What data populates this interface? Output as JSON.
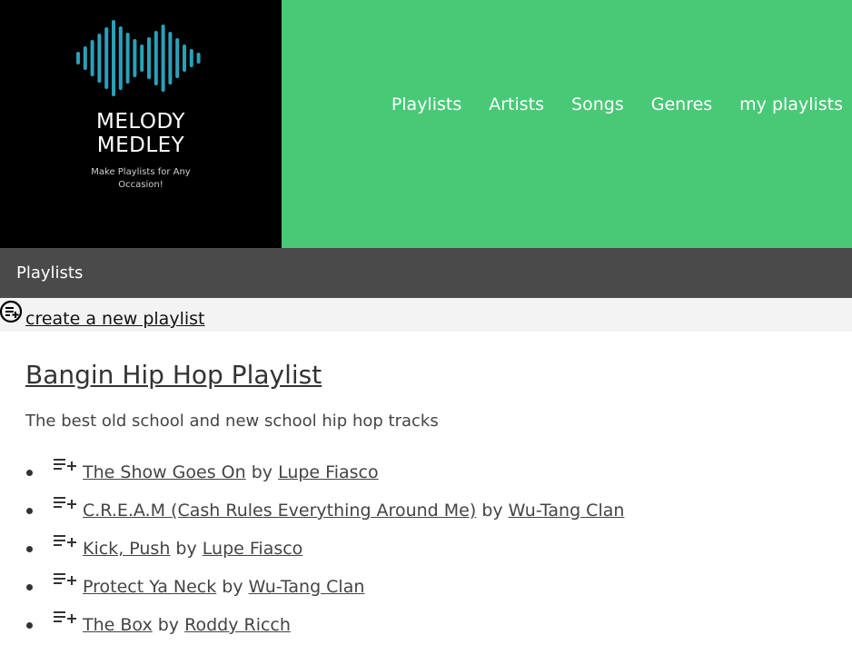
{
  "brand": {
    "name_line1": "MELODY",
    "name_line2": "MEDLEY",
    "tagline_line1": "Make Playlists for Any",
    "tagline_line2": "Occasion!"
  },
  "nav": {
    "items": [
      "Playlists",
      "Artists",
      "Songs",
      "Genres",
      "my playlists"
    ]
  },
  "subheader": {
    "title": "Playlists"
  },
  "create": {
    "label": "create a new playlist",
    "icon": "playlist-add-circle-icon"
  },
  "playlist": {
    "title": "Bangin Hip Hop Playlist",
    "description": "The best old school and new school hip hop tracks",
    "by_word": "by",
    "tracks": [
      {
        "song": "The Show Goes On",
        "artist": "Lupe Fiasco"
      },
      {
        "song": "C.R.E.A.M (Cash Rules Everything Around Me)",
        "artist": "Wu-Tang Clan"
      },
      {
        "song": "Kick, Push",
        "artist": "Lupe Fiasco"
      },
      {
        "song": "Protect Ya Neck",
        "artist": "Wu-Tang Clan"
      },
      {
        "song": "The Box",
        "artist": "Roddy Ricch"
      }
    ]
  },
  "colors": {
    "header_green": "#48c976",
    "logo_bg": "#000000",
    "logo_wave": "#2aa0b8",
    "subbar": "#4a4a4a",
    "createbar": "#f3f3f3"
  }
}
